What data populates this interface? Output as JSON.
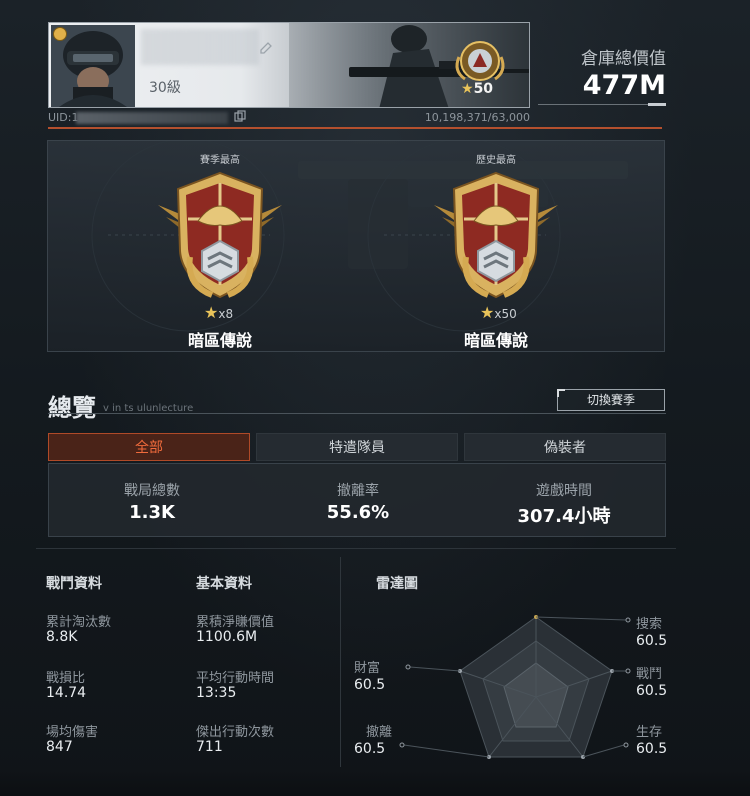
{
  "profile": {
    "level": "30級",
    "rank_stars": "50",
    "uid_label": "UID:1",
    "xp": "10,198,371/63,000"
  },
  "assets": {
    "label": "倉庫總價值",
    "value": "477M"
  },
  "ranks": {
    "season": {
      "title": "賽季最高",
      "count": "x8",
      "name": "暗區傳說"
    },
    "history": {
      "title": "歷史最高",
      "count": "x50",
      "name": "暗區傳說"
    }
  },
  "overview": {
    "title": "總覽",
    "subtitle": "v in ts ulunlecture",
    "switch_season": "切換賽季",
    "tabs": [
      "全部",
      "特遣隊員",
      "偽裝者"
    ],
    "active_tab": 0,
    "summary": [
      {
        "label": "戰局總數",
        "value": "1.3K"
      },
      {
        "label": "撤離率",
        "value": "55.6%"
      },
      {
        "label": "遊戲時間",
        "value": "307.4小時"
      }
    ]
  },
  "combat": {
    "title": "戰鬥資料",
    "items": [
      {
        "label": "累計淘汰數",
        "value": "8.8K"
      },
      {
        "label": "戰損比",
        "value": "14.74"
      },
      {
        "label": "場均傷害",
        "value": "847"
      }
    ]
  },
  "basic": {
    "title": "基本資料",
    "items": [
      {
        "label": "累積淨賺價值",
        "value": "1100.6M"
      },
      {
        "label": "平均行動時間",
        "value": "13:35"
      },
      {
        "label": "傑出行動次數",
        "value": "711"
      }
    ]
  },
  "radar": {
    "title": "雷達圖",
    "axes": [
      {
        "label": "搜索",
        "value": "60.5"
      },
      {
        "label": "戰鬥",
        "value": "60.5"
      },
      {
        "label": "生存",
        "value": "60.5"
      },
      {
        "label": "撤離",
        "value": "60.5"
      },
      {
        "label": "財富",
        "value": "60.5"
      }
    ]
  },
  "icons": {
    "edit": "edit-icon",
    "copy": "copy-icon",
    "star": "star-icon"
  },
  "colors": {
    "accent": "#f06b3c",
    "accent_bg": "#4a2318",
    "gold": "#e8c35a"
  }
}
